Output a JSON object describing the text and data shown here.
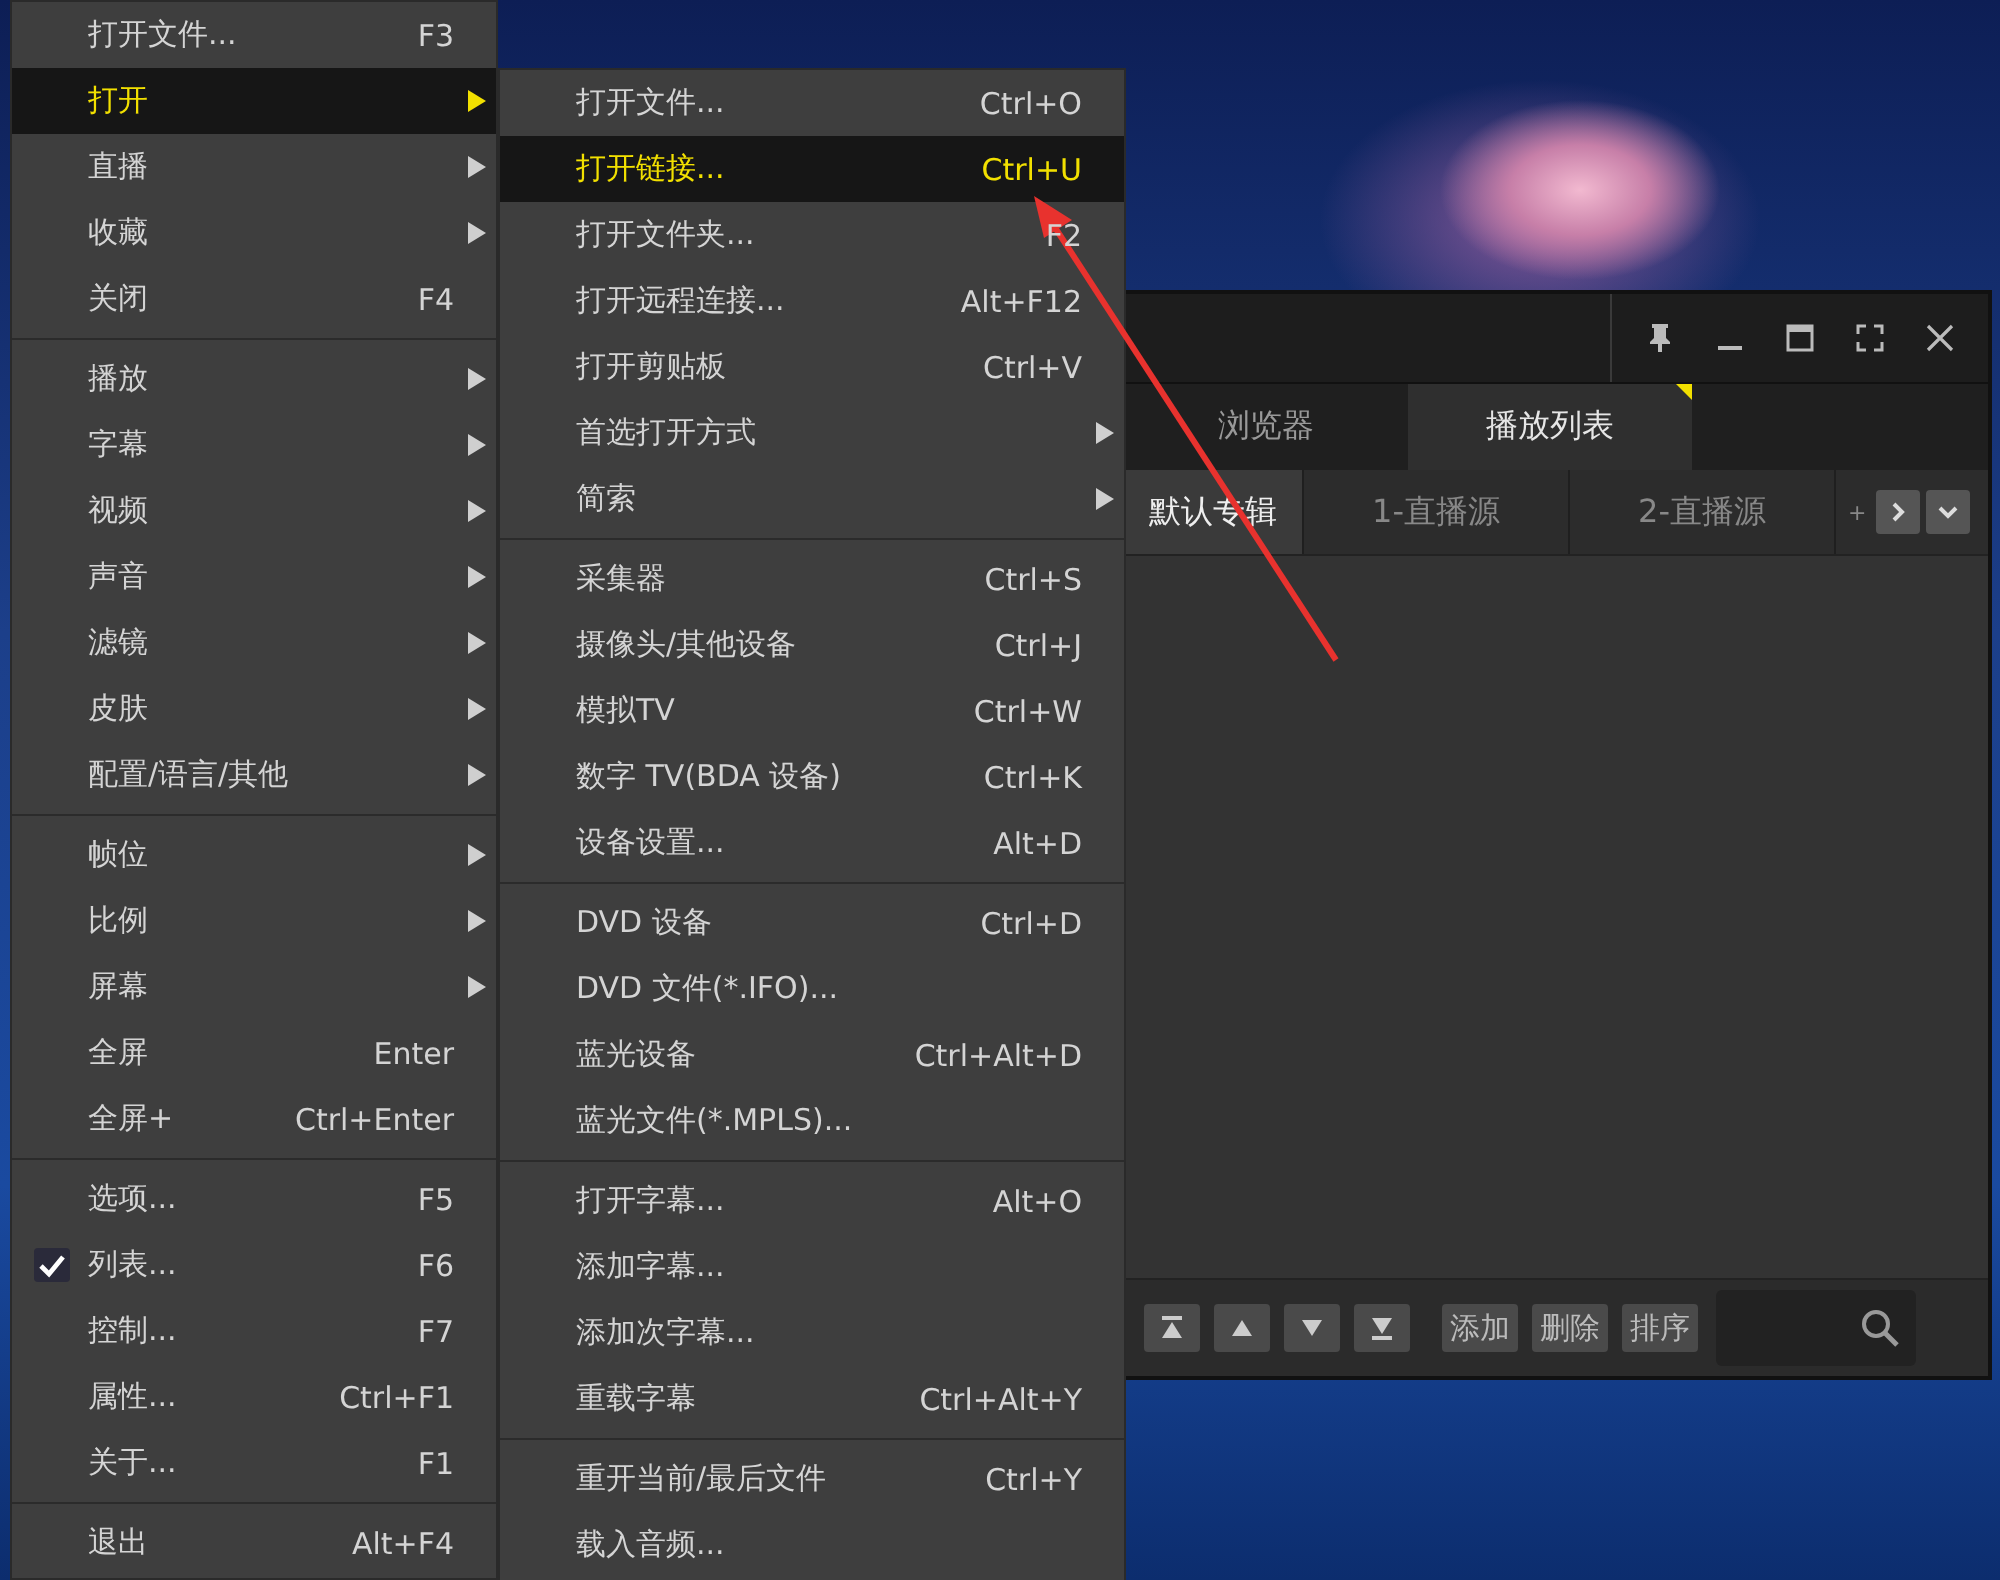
{
  "main_menu": {
    "groups": [
      [
        {
          "label": "打开文件...",
          "shortcut": "F3",
          "has_submenu": false,
          "selected": false,
          "checked": false
        },
        {
          "label": "打开",
          "has_submenu": true,
          "selected": true,
          "checked": false
        },
        {
          "label": "直播",
          "has_submenu": true,
          "selected": false,
          "checked": false
        },
        {
          "label": "收藏",
          "has_submenu": true,
          "selected": false,
          "checked": false
        },
        {
          "label": "关闭",
          "shortcut": "F4",
          "has_submenu": false,
          "selected": false,
          "checked": false
        }
      ],
      [
        {
          "label": "播放",
          "has_submenu": true,
          "selected": false,
          "checked": false
        },
        {
          "label": "字幕",
          "has_submenu": true,
          "selected": false,
          "checked": false
        },
        {
          "label": "视频",
          "has_submenu": true,
          "selected": false,
          "checked": false
        },
        {
          "label": "声音",
          "has_submenu": true,
          "selected": false,
          "checked": false
        },
        {
          "label": "滤镜",
          "has_submenu": true,
          "selected": false,
          "checked": false
        },
        {
          "label": "皮肤",
          "has_submenu": true,
          "selected": false,
          "checked": false
        },
        {
          "label": "配置/语言/其他",
          "has_submenu": true,
          "selected": false,
          "checked": false
        }
      ],
      [
        {
          "label": "帧位",
          "has_submenu": true,
          "selected": false,
          "checked": false
        },
        {
          "label": "比例",
          "has_submenu": true,
          "selected": false,
          "checked": false
        },
        {
          "label": "屏幕",
          "has_submenu": true,
          "selected": false,
          "checked": false
        },
        {
          "label": "全屏",
          "shortcut": "Enter",
          "has_submenu": false,
          "selected": false,
          "checked": false
        },
        {
          "label": "全屏+",
          "shortcut": "Ctrl+Enter",
          "has_submenu": false,
          "selected": false,
          "checked": false
        }
      ],
      [
        {
          "label": "选项...",
          "shortcut": "F5",
          "has_submenu": false,
          "selected": false,
          "checked": false
        },
        {
          "label": "列表...",
          "shortcut": "F6",
          "has_submenu": false,
          "selected": false,
          "checked": true
        },
        {
          "label": "控制...",
          "shortcut": "F7",
          "has_submenu": false,
          "selected": false,
          "checked": false
        },
        {
          "label": "属性...",
          "shortcut": "Ctrl+F1",
          "has_submenu": false,
          "selected": false,
          "checked": false
        },
        {
          "label": "关于...",
          "shortcut": "F1",
          "has_submenu": false,
          "selected": false,
          "checked": false
        }
      ],
      [
        {
          "label": "退出",
          "shortcut": "Alt+F4",
          "has_submenu": false,
          "selected": false,
          "checked": false
        }
      ]
    ]
  },
  "submenu": {
    "groups": [
      [
        {
          "label": "打开文件...",
          "shortcut": "Ctrl+O",
          "has_submenu": false,
          "selected": false,
          "checked": false
        },
        {
          "label": "打开链接...",
          "shortcut": "Ctrl+U",
          "has_submenu": false,
          "selected": true,
          "checked": false
        },
        {
          "label": "打开文件夹...",
          "shortcut": "F2",
          "has_submenu": false,
          "selected": false,
          "checked": false
        },
        {
          "label": "打开远程连接...",
          "shortcut": "Alt+F12",
          "has_submenu": false,
          "selected": false,
          "checked": false
        },
        {
          "label": "打开剪贴板",
          "shortcut": "Ctrl+V",
          "has_submenu": false,
          "selected": false,
          "checked": false
        },
        {
          "label": "首选打开方式",
          "has_submenu": true,
          "selected": false,
          "checked": false
        },
        {
          "label": "简索",
          "has_submenu": true,
          "selected": false,
          "checked": false
        }
      ],
      [
        {
          "label": "采集器",
          "shortcut": "Ctrl+S",
          "has_submenu": false,
          "selected": false,
          "checked": false
        },
        {
          "label": "摄像头/其他设备",
          "shortcut": "Ctrl+J",
          "has_submenu": false,
          "selected": false,
          "checked": false
        },
        {
          "label": "模拟TV",
          "shortcut": "Ctrl+W",
          "has_submenu": false,
          "selected": false,
          "checked": false
        },
        {
          "label": "数字 TV(BDA 设备)",
          "shortcut": "Ctrl+K",
          "has_submenu": false,
          "selected": false,
          "checked": false
        },
        {
          "label": "设备设置...",
          "shortcut": "Alt+D",
          "has_submenu": false,
          "selected": false,
          "checked": false
        }
      ],
      [
        {
          "label": "DVD 设备",
          "shortcut": "Ctrl+D",
          "has_submenu": false,
          "selected": false,
          "checked": false
        },
        {
          "label": "DVD 文件(*.IFO)...",
          "has_submenu": false,
          "selected": false,
          "checked": false
        },
        {
          "label": "蓝光设备",
          "shortcut": "Ctrl+Alt+D",
          "has_submenu": false,
          "selected": false,
          "checked": false
        },
        {
          "label": "蓝光文件(*.MPLS)...",
          "has_submenu": false,
          "selected": false,
          "checked": false
        }
      ],
      [
        {
          "label": "打开字幕...",
          "shortcut": "Alt+O",
          "has_submenu": false,
          "selected": false,
          "checked": false
        },
        {
          "label": "添加字幕...",
          "has_submenu": false,
          "selected": false,
          "checked": false
        },
        {
          "label": "添加次字幕...",
          "has_submenu": false,
          "selected": false,
          "checked": false
        },
        {
          "label": "重载字幕",
          "shortcut": "Ctrl+Alt+Y",
          "has_submenu": false,
          "selected": false,
          "checked": false
        }
      ],
      [
        {
          "label": "重开当前/最后文件",
          "shortcut": "Ctrl+Y",
          "has_submenu": false,
          "selected": false,
          "checked": false
        },
        {
          "label": "载入音频...",
          "has_submenu": false,
          "selected": false,
          "checked": false
        }
      ]
    ]
  },
  "player": {
    "tabs": [
      {
        "label": "浏览器",
        "selected": false
      },
      {
        "label": "播放列表",
        "selected": true
      }
    ],
    "album_tabs": [
      {
        "label": "默认专辑",
        "selected": true
      },
      {
        "label": "1-直播源",
        "selected": false
      },
      {
        "label": "2-直播源",
        "selected": false
      }
    ],
    "more_label": "+",
    "toolbar_buttons": [
      "添加",
      "删除",
      "排序"
    ]
  }
}
